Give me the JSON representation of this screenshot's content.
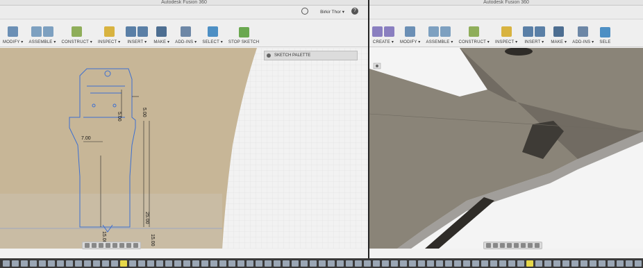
{
  "left_window": {
    "title": "Autodesk Fusion 360",
    "user": "Birkir Thor",
    "toolbar": [
      {
        "label": "MODIFY ▾",
        "icons": [
          "modify-icon"
        ],
        "color": "#6b8fb5"
      },
      {
        "label": "ASSEMBLE ▾",
        "icons": [
          "assemble-icon",
          "joint-icon"
        ],
        "color": "#7da0c0"
      },
      {
        "label": "CONSTRUCT ▾",
        "icons": [
          "construct-icon"
        ],
        "color": "#8fae5a"
      },
      {
        "label": "INSPECT ▾",
        "icons": [
          "inspect-icon"
        ],
        "color": "#d8b340"
      },
      {
        "label": "INSERT ▾",
        "icons": [
          "insert-image-icon",
          "insert-svg-icon"
        ],
        "color": "#5a7fa6"
      },
      {
        "label": "MAKE ▾",
        "icons": [
          "make-icon"
        ],
        "color": "#4d6e91"
      },
      {
        "label": "ADD-INS ▾",
        "icons": [
          "add-ins-icon"
        ],
        "color": "#6d87a6"
      },
      {
        "label": "SELECT ▾",
        "icons": [
          "select-icon"
        ],
        "color": "#4d8fc4"
      },
      {
        "label": "STOP SKETCH",
        "icons": [
          "stop-sketch-icon"
        ],
        "color": "#6aa84f"
      }
    ],
    "sketch_palette_label": "SKETCH PALETTE",
    "dimensions": [
      "5.00",
      "5.00",
      "7.00",
      "25.00",
      "15.00",
      "15.00"
    ]
  },
  "right_window": {
    "title": "Autodesk Fusion 360",
    "toolbar": [
      {
        "label": "CREATE ▾",
        "icons": [
          "create-box-icon",
          "create-sphere-icon"
        ],
        "color": "#8a7fc0"
      },
      {
        "label": "MODIFY ▾",
        "icons": [
          "modify-icon"
        ],
        "color": "#6b8fb5"
      },
      {
        "label": "ASSEMBLE ▾",
        "icons": [
          "assemble-icon",
          "joint-icon"
        ],
        "color": "#7da0c0"
      },
      {
        "label": "CONSTRUCT ▾",
        "icons": [
          "construct-icon"
        ],
        "color": "#8fae5a"
      },
      {
        "label": "INSPECT ▾",
        "icons": [
          "inspect-icon"
        ],
        "color": "#d8b340"
      },
      {
        "label": "INSERT ▾",
        "icons": [
          "insert-image-icon",
          "insert-svg-icon"
        ],
        "color": "#5a7fa6"
      },
      {
        "label": "MAKE ▾",
        "icons": [
          "make-icon"
        ],
        "color": "#4d6e91"
      },
      {
        "label": "ADD-INS ▾",
        "icons": [
          "add-ins-icon"
        ],
        "color": "#6d87a6"
      },
      {
        "label": "SELE",
        "icons": [
          "select-icon"
        ],
        "color": "#4d8fc4"
      }
    ]
  },
  "colors": {
    "sketch_plane": "#c7b697",
    "grid_bg": "#f4f4f4",
    "sketch_line": "#3c6fd1",
    "model_top": "#8a8478",
    "model_side": "#5c5850"
  }
}
